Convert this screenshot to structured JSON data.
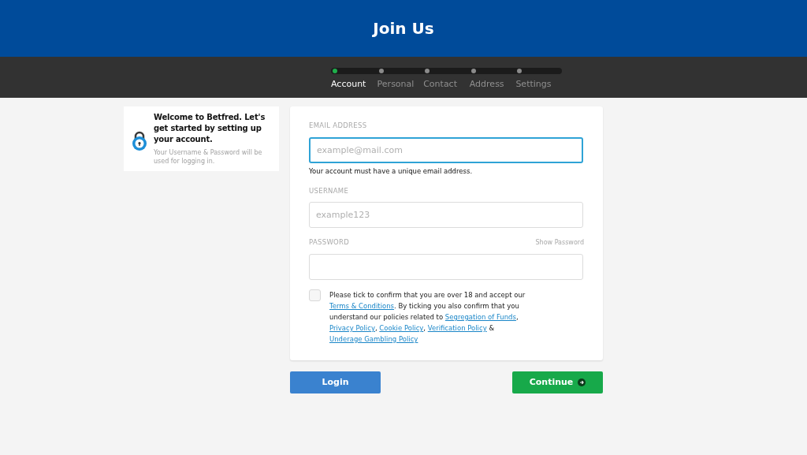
{
  "header": {
    "title": "Join Us"
  },
  "steps": [
    {
      "label": "Account",
      "selected": true
    },
    {
      "label": "Personal",
      "selected": false
    },
    {
      "label": "Contact",
      "selected": false
    },
    {
      "label": "Address",
      "selected": false
    },
    {
      "label": "Settings",
      "selected": false
    }
  ],
  "info_card": {
    "title": "Welcome to Betfred. Let's get started by setting up your account.",
    "subtitle": "Your Username & Password will be used for logging in."
  },
  "form": {
    "fields": [
      {
        "label": "EMAIL ADDRESS",
        "placeholder": "example@mail.com",
        "focused": true,
        "hint": "Your account must have a unique email address."
      },
      {
        "label": "USERNAME",
        "placeholder": "example123",
        "focused": false
      },
      {
        "label": "PASSWORD",
        "focused": false,
        "action": "Show Password"
      }
    ],
    "consent": {
      "checked": false,
      "parts": [
        {
          "kind": "text",
          "text": "Please tick to confirm that you are over 18 and accept our "
        },
        {
          "kind": "link",
          "text": "Terms & Conditions"
        },
        {
          "kind": "text",
          "text": ". By ticking you also confirm that you understand our policies related to "
        },
        {
          "kind": "link",
          "text": "Segregation of Funds"
        },
        {
          "kind": "text",
          "text": ", "
        },
        {
          "kind": "link",
          "text": "Privacy Policy"
        },
        {
          "kind": "text",
          "text": ", "
        },
        {
          "kind": "link",
          "text": "Cookie Policy"
        },
        {
          "kind": "text",
          "text": ", "
        },
        {
          "kind": "link",
          "text": "Verification Policy"
        },
        {
          "kind": "text",
          "text": " & "
        },
        {
          "kind": "link",
          "text": "Underage Gambling Policy"
        }
      ]
    }
  },
  "buttons": {
    "login": "Login",
    "continue": "Continue"
  }
}
